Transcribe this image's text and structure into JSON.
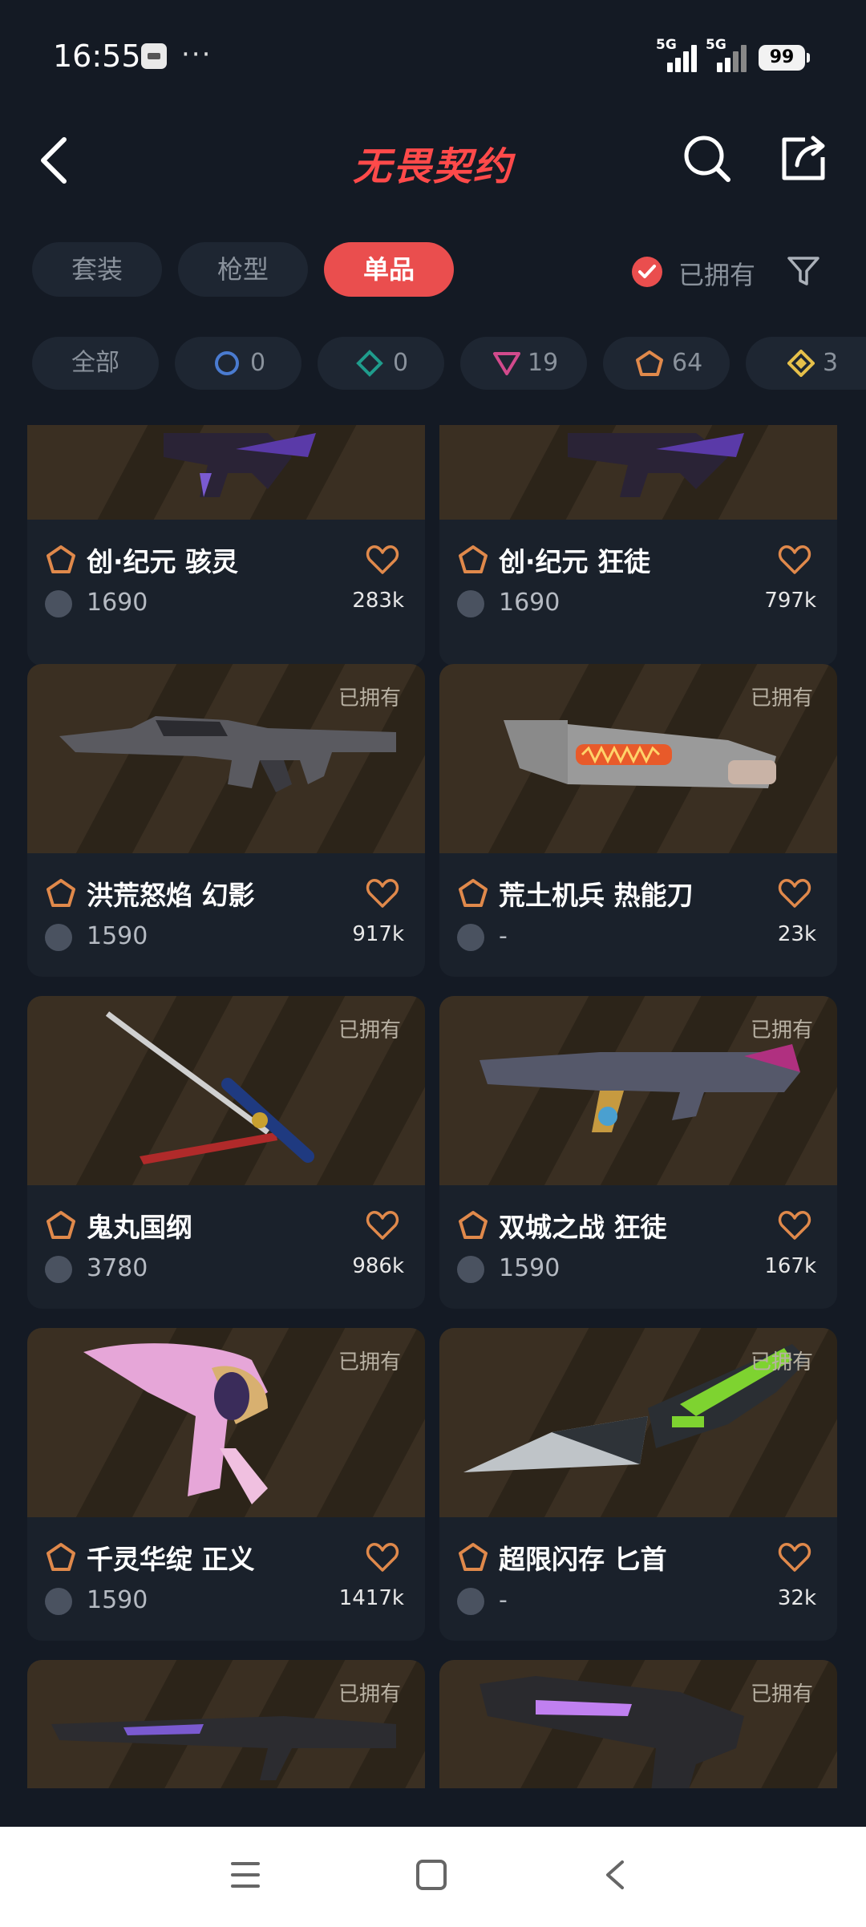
{
  "status_bar": {
    "time": "16:55",
    "more": "···",
    "signal1_label": "5G",
    "signal2_label": "5G",
    "battery": "99"
  },
  "header": {
    "title": "无畏契约"
  },
  "tabs": [
    {
      "label": "套装",
      "active": false
    },
    {
      "label": "枪型",
      "active": false
    },
    {
      "label": "单品",
      "active": true
    }
  ],
  "owned_filter_label": "已拥有",
  "tier_chips": [
    {
      "label": "全部"
    },
    {
      "tier": "select",
      "count": "0",
      "color": "#4a7bd0"
    },
    {
      "tier": "deluxe",
      "count": "0",
      "color": "#1f9c8c"
    },
    {
      "tier": "premium",
      "count": "19",
      "color": "#d24a8c"
    },
    {
      "tier": "exclusive",
      "count": "64",
      "color": "#e0894b"
    },
    {
      "tier": "ultra",
      "count": "3",
      "color": "#e6c04a"
    }
  ],
  "cards": [
    {
      "name": "创·纪元 骇灵",
      "price": "1690",
      "likes": "283k",
      "owned": "",
      "tier_color": "#e0894b"
    },
    {
      "name": "创·纪元 狂徒",
      "price": "1690",
      "likes": "797k",
      "owned": "",
      "tier_color": "#e0894b"
    },
    {
      "name": "洪荒怒焰 幻影",
      "price": "1590",
      "likes": "917k",
      "owned": "已拥有",
      "tier_color": "#e0894b"
    },
    {
      "name": "荒土机兵 热能刀",
      "price": "-",
      "likes": "23k",
      "owned": "已拥有",
      "tier_color": "#e0894b"
    },
    {
      "name": "鬼丸国纲",
      "price": "3780",
      "likes": "986k",
      "owned": "已拥有",
      "tier_color": "#e0894b"
    },
    {
      "name": "双城之战 狂徒",
      "price": "1590",
      "likes": "167k",
      "owned": "已拥有",
      "tier_color": "#e0894b"
    },
    {
      "name": "千灵华绽 正义",
      "price": "1590",
      "likes": "1417k",
      "owned": "已拥有",
      "tier_color": "#e0894b"
    },
    {
      "name": "超限闪存 匕首",
      "price": "-",
      "likes": "32k",
      "owned": "已拥有",
      "tier_color": "#e0894b"
    },
    {
      "name": "",
      "price": "",
      "likes": "",
      "owned": "已拥有",
      "tier_color": "#e0894b"
    },
    {
      "name": "",
      "price": "",
      "likes": "",
      "owned": "已拥有",
      "tier_color": "#e0894b"
    }
  ],
  "colors": {
    "accent": "#ea4e4e",
    "background": "#141a24",
    "chip_bg": "#1e2632",
    "heart": "#e0894b"
  },
  "icons": {
    "back": "chevron-left-icon",
    "search": "search-icon",
    "share": "share-icon",
    "filter": "filter-icon",
    "owned_check": "check-circle-icon",
    "tier": "tier-icon",
    "heart": "heart-outline-icon",
    "currency": "vp-currency-icon",
    "nav_menu": "menu-icon",
    "nav_home": "home-square-icon",
    "nav_back": "back-triangle-icon"
  }
}
